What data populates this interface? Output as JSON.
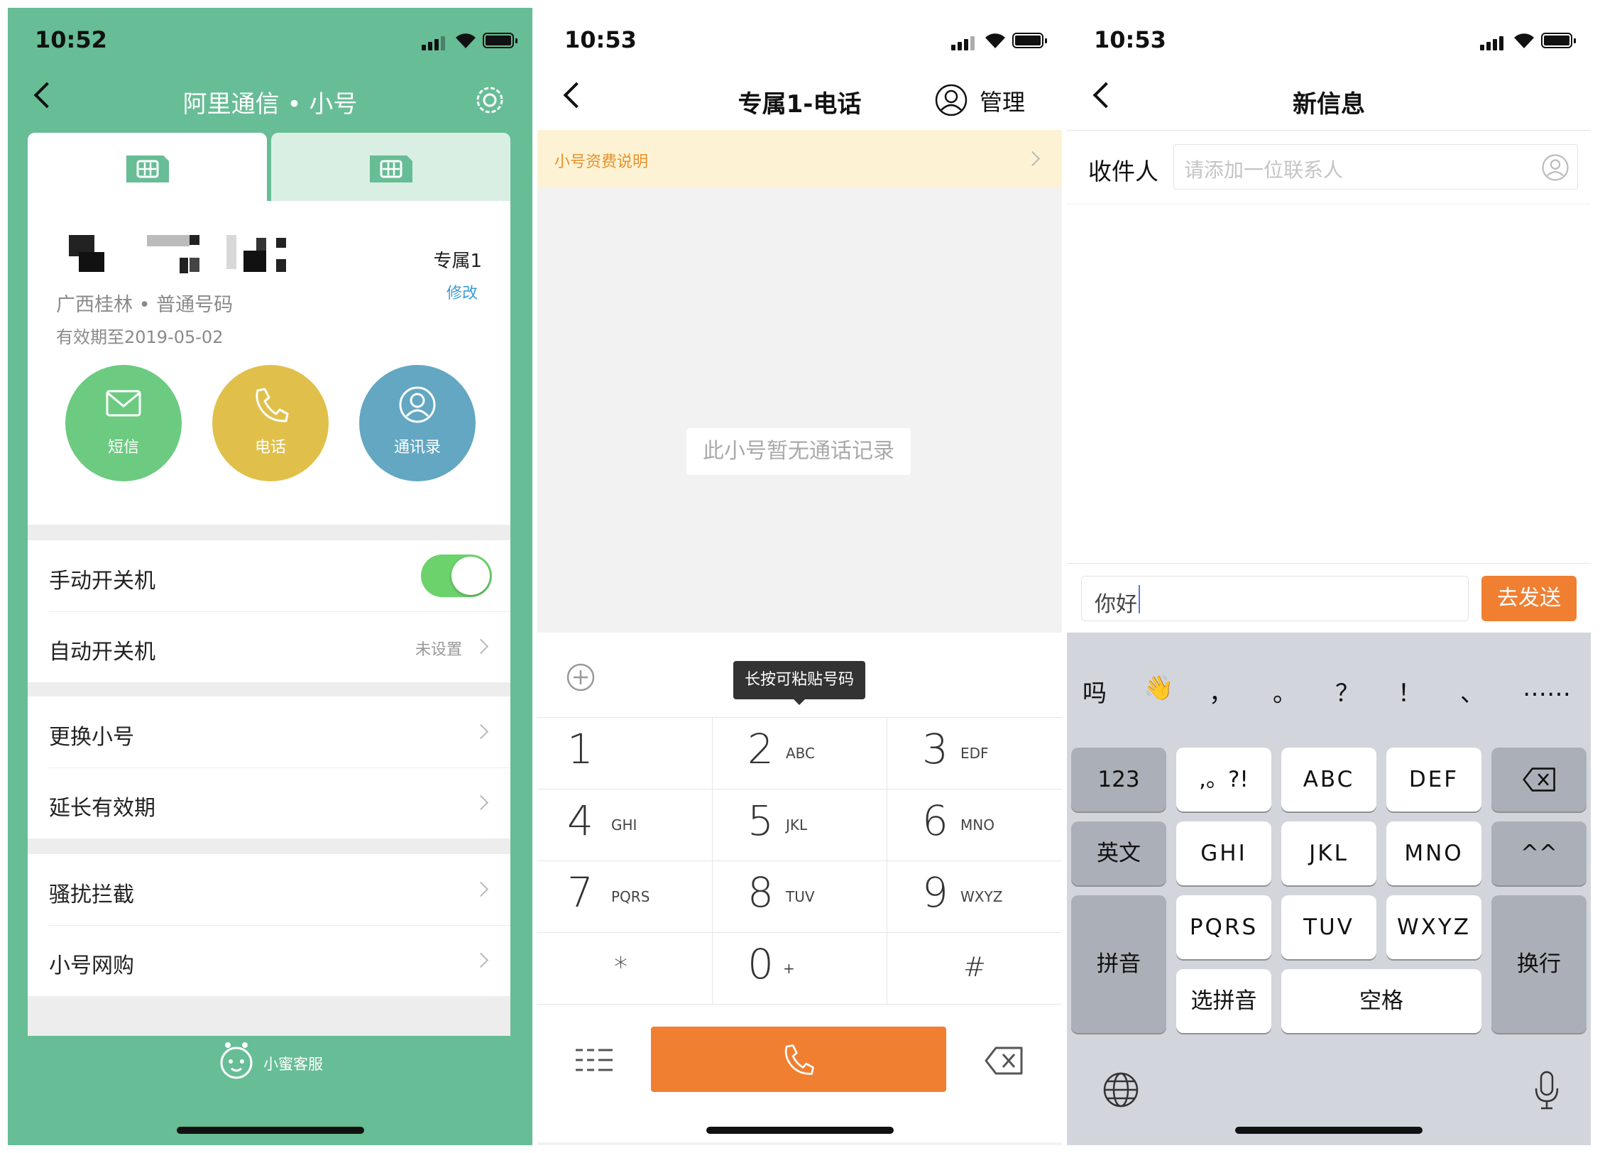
{
  "panel1": {
    "status_time": "10:52",
    "title": "阿里通信 • 小号",
    "tabs": [
      "",
      ""
    ],
    "number": {
      "label": "专属1",
      "edit": "修改",
      "region": "广西桂林 • 普通号码",
      "expiry": "有效期至2019-05-02"
    },
    "actions": [
      {
        "label": "短信",
        "color": "#6ccb80",
        "icon": "mail-icon"
      },
      {
        "label": "电话",
        "color": "#e0c04a",
        "icon": "phone-icon"
      },
      {
        "label": "通讯录",
        "color": "#63a7c2",
        "icon": "contact-icon"
      }
    ],
    "settings": {
      "manual_power": "手动开关机",
      "manual_power_on": true,
      "auto_power": "自动开关机",
      "auto_power_value": "未设置",
      "change_number": "更换小号",
      "extend": "延长有效期",
      "block": "骚扰拦截",
      "shop": "小号网购"
    },
    "footer": "小蜜客服",
    "colors": {
      "bg": "#67bd95",
      "link": "#3d9bd9"
    }
  },
  "panel2": {
    "status_time": "10:53",
    "title": "专属1-电话",
    "manage": "管理",
    "notice": "小号资费说明",
    "empty": "此小号暂无通话记录",
    "tooltip": "长按可粘贴号码",
    "keys": [
      {
        "d": "1",
        "l": ""
      },
      {
        "d": "2",
        "l": "ABC"
      },
      {
        "d": "3",
        "l": "EDF"
      },
      {
        "d": "4",
        "l": "GHI"
      },
      {
        "d": "5",
        "l": "JKL"
      },
      {
        "d": "6",
        "l": "MNO"
      },
      {
        "d": "7",
        "l": "PQRS"
      },
      {
        "d": "8",
        "l": "TUV"
      },
      {
        "d": "9",
        "l": "WXYZ"
      },
      {
        "d": "*",
        "l": ""
      },
      {
        "d": "0",
        "l": "+"
      },
      {
        "d": "#",
        "l": ""
      }
    ],
    "colors": {
      "accent": "#f07f32",
      "notice_bg": "#fdf3d4",
      "notice_text": "#e8902a"
    }
  },
  "panel3": {
    "status_time": "10:53",
    "title": "新信息",
    "recipient_label": "收件人",
    "recipient_placeholder": "请添加一位联系人",
    "message": "你好",
    "send": "去发送",
    "candidates": [
      "吗",
      "👋",
      "，",
      "。",
      "？",
      "！",
      "、",
      "……"
    ],
    "keys": {
      "k123": "123",
      "punct": ",。?!",
      "abc": "ABC",
      "def": "DEF",
      "english": "英文",
      "ghi": "GHI",
      "jkl": "JKL",
      "mno": "MNO",
      "face": "^^",
      "pinyin": "拼音",
      "pqrs": "PQRS",
      "tuv": "TUV",
      "wxyz": "WXYZ",
      "enter": "换行",
      "select_pinyin": "选拼音",
      "space": "空格"
    },
    "colors": {
      "send": "#f07f32",
      "kb_bg": "#d2d5db"
    }
  }
}
